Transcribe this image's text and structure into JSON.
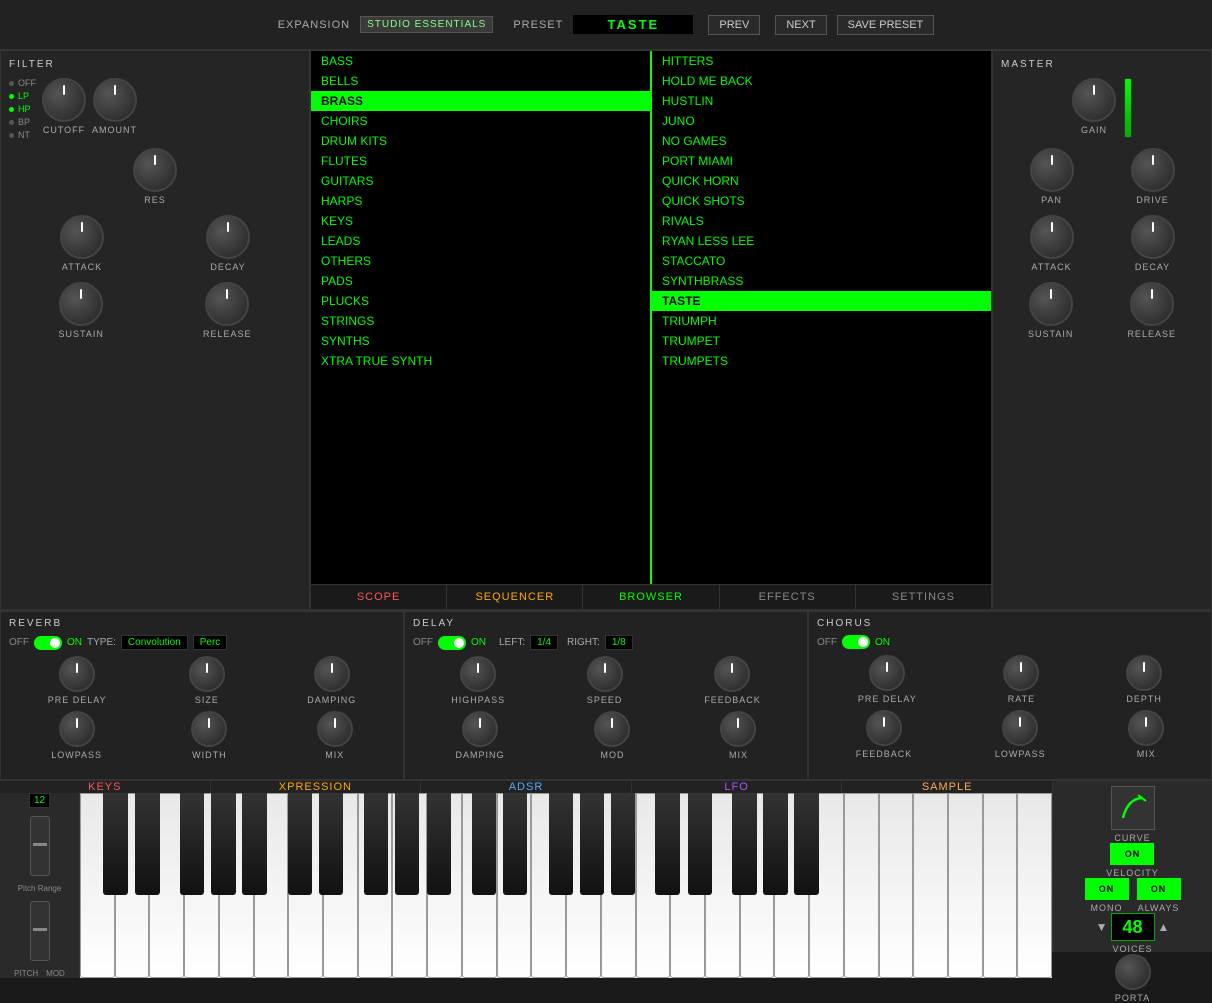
{
  "topbar": {
    "expansion_label": "EXPANSION",
    "expansion_badge": "STUDIO ESSENTIALS",
    "preset_label": "PRESET",
    "preset_value": "TASTE",
    "prev_label": "PREV",
    "next_label": "NEXT",
    "save_label": "SAVE PRESET"
  },
  "filter": {
    "title": "FILTER",
    "types": [
      "OFF",
      "LP",
      "HP",
      "BP",
      "NT"
    ],
    "knobs": [
      "CUTOFF",
      "AMOUNT",
      "RES",
      "ATTACK",
      "DECAY",
      "SUSTAIN",
      "RELEASE"
    ]
  },
  "master": {
    "title": "MASTER",
    "knobs": [
      "GAIN",
      "PAN",
      "DRIVE",
      "ATTACK",
      "DECAY",
      "SUSTAIN",
      "RELEASE"
    ]
  },
  "browser": {
    "categories": [
      "BASS",
      "BELLS",
      "BRASS",
      "CHOIRS",
      "DRUM KITS",
      "FLUTES",
      "GUITARS",
      "HARPS",
      "KEYS",
      "LEADS",
      "OTHERS",
      "PADS",
      "PLUCKS",
      "STRINGS",
      "SYNTHS",
      "XTRA TRUE SYNTH"
    ],
    "presets": [
      "HITTERS",
      "HOLD ME BACK",
      "HUSTLIN",
      "JUNO",
      "NO GAMES",
      "PORT MIAMI",
      "QUICK HORN",
      "QUICK SHOTS",
      "RIVALS",
      "RYAN LESS LEE",
      "STACCATO",
      "SYNTHBRASS",
      "TASTE",
      "TRIUMPH",
      "TRUMPET",
      "TRUMPETS"
    ],
    "selected_category": "BRASS",
    "selected_preset": "TASTE",
    "tabs": [
      "SCOPE",
      "SEQUENCER",
      "BROWSER",
      "EFFECTS",
      "SETTINGS"
    ],
    "active_tab": "BROWSER"
  },
  "reverb": {
    "title": "REVERB",
    "off_label": "OFF",
    "on_label": "ON",
    "type_label": "TYPE:",
    "type_value": "Convolution",
    "preset_value": "Perc",
    "knobs": [
      "PRE DELAY",
      "SIZE",
      "DAMPING",
      "LOWPASS",
      "WIDTH",
      "MIX"
    ]
  },
  "delay": {
    "title": "DELAY",
    "off_label": "OFF",
    "on_label": "ON",
    "left_label": "LEFT:",
    "left_value": "1/4",
    "right_label": "RIGHT:",
    "right_value": "1/8",
    "knobs": [
      "HIGHPASS",
      "SPEED",
      "FEEDBACK",
      "DAMPING",
      "MOD",
      "MIX"
    ]
  },
  "chorus": {
    "title": "CHORUS",
    "off_label": "OFF",
    "on_label": "ON",
    "knobs": [
      "PRE DELAY",
      "RATE",
      "DEPTH",
      "FEEDBACK",
      "LOWPASS",
      "MIX"
    ]
  },
  "keyboard": {
    "tabs": [
      "KEYS",
      "XPRESSION",
      "ADSR",
      "LFO",
      "SAMPLE"
    ],
    "pitch_range_label": "Pitch Range",
    "pitch_value": "12",
    "pitch_label": "PITCH",
    "mod_label": "MOD"
  },
  "right_controls": {
    "curve_label": "CURVE",
    "velocity_label": "VELOCITY",
    "velocity_on": "ON",
    "mono_label": "MONO",
    "mono_on": "ON",
    "always_label": "ALWAYS",
    "always_on": "ON",
    "voices_label": "VOICES",
    "voices_value": "48",
    "porta_label": "PORTA"
  }
}
